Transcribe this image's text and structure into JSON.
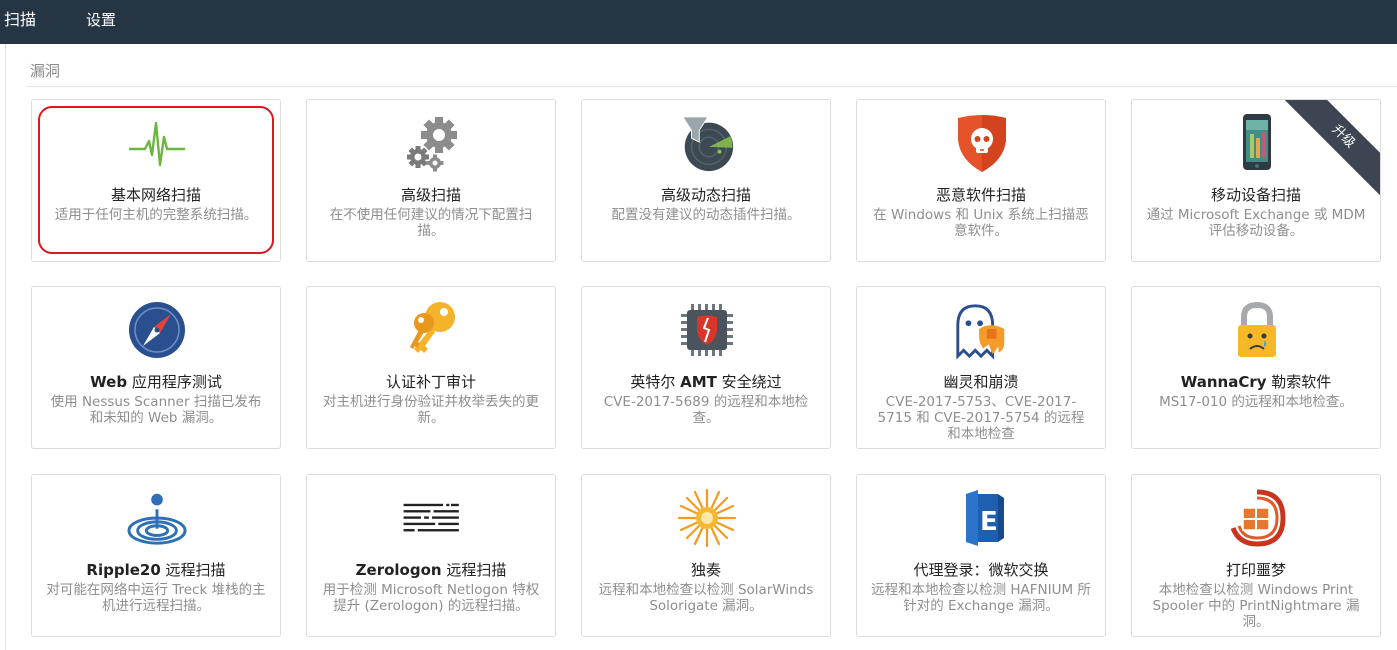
{
  "nav": {
    "scan": "扫描",
    "settings": "设置"
  },
  "section": {
    "title": "漏洞"
  },
  "badges": {
    "upgrade": "升级"
  },
  "cards": [
    {
      "title": "基本网络扫描",
      "desc": "适用于任何主机的完整系统扫描。",
      "icon": "heartbeat-icon"
    },
    {
      "title": "高级扫描",
      "desc": "在不使用任何建议的情况下配置扫描。",
      "icon": "gears-icon"
    },
    {
      "title": "高级动态扫描",
      "desc": "配置没有建议的动态插件扫描。",
      "icon": "radar-filter-icon"
    },
    {
      "title": "恶意软件扫描",
      "desc": "在 Windows 和 Unix 系统上扫描恶意软件。",
      "icon": "skull-shield-icon"
    },
    {
      "title": "移动设备扫描",
      "desc": "通过 Microsoft Exchange 或 MDM 评估移动设备。",
      "icon": "mobile-phone-icon"
    },
    {
      "title_bold": "Web",
      "title_rest": " 应用程序测试",
      "desc": "使用 Nessus Scanner 扫描已发布和未知的 Web 漏洞。",
      "icon": "compass-icon"
    },
    {
      "title": "认证补丁审计",
      "desc": "对主机进行身份验证并枚举丢失的更新。",
      "icon": "keys-icon"
    },
    {
      "title_pre": "英特尔 ",
      "title_bold": "AMT",
      "title_rest": " 安全绕过",
      "desc": "CVE-2017-5689 的远程和本地检查。",
      "icon": "chip-shield-icon"
    },
    {
      "title": "幽灵和崩溃",
      "desc": "CVE-2017-5753、CVE-2017-5715 和 CVE-2017-5754 的远程和本地检查",
      "icon": "ghost-meltdown-icon"
    },
    {
      "title_bold": "WannaCry",
      "title_rest": " 勒索软件",
      "desc": "MS17-010 的远程和本地检查。",
      "icon": "crying-lock-icon"
    },
    {
      "title_bold": "Ripple20",
      "title_rest": " 远程扫描",
      "desc": "对可能在网络中运行 Treck 堆栈的主机进行远程扫描。",
      "icon": "ripple-drop-icon"
    },
    {
      "title_bold": "Zerologon",
      "title_rest": " 远程扫描",
      "desc": "用于检测 Microsoft Netlogon 特权提升 (Zerologon) 的远程扫描。",
      "icon": "zerologon-code-icon"
    },
    {
      "title": "独奏",
      "desc": "远程和本地检查以检测 SolarWinds Solorigate 漏洞。",
      "icon": "solar-burst-icon"
    },
    {
      "title": "代理登录：微软交换",
      "desc": "远程和本地检查以检测 HAFNIUM 所针对的 Exchange 漏洞。",
      "icon": "exchange-icon"
    },
    {
      "title": "打印噩梦",
      "desc": "本地检查以检测 Windows Print Spooler 中的 PrintNightmare 漏洞。",
      "icon": "printnightmare-icon"
    }
  ]
}
